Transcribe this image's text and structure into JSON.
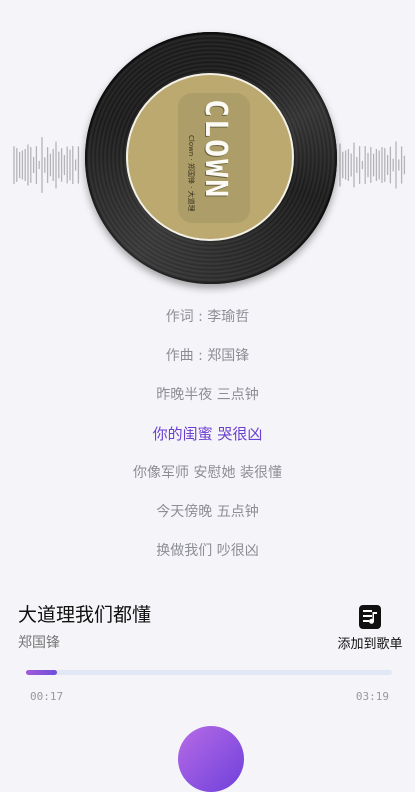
{
  "album": {
    "cover_title": "CLOWN",
    "cover_subtitle": "Clown · 郑国锋 · 大道理",
    "cover_color": "#bba970"
  },
  "lyrics": [
    {
      "text": "作词 : 李瑜哲",
      "active": false
    },
    {
      "text": "作曲 : 郑国锋",
      "active": false
    },
    {
      "text": "昨晚半夜 三点钟",
      "active": false
    },
    {
      "text": "你的闺蜜 哭很凶",
      "active": true
    },
    {
      "text": "你像军师 安慰她 装很懂",
      "active": false
    },
    {
      "text": "今天傍晚 五点钟",
      "active": false
    },
    {
      "text": "换做我们 吵很凶",
      "active": false
    }
  ],
  "song": {
    "title": "大道理我们都懂",
    "artist": "郑国锋"
  },
  "actions": {
    "add_to_playlist_label": "添加到歌单",
    "add_to_playlist_icon": "playlist-add-icon"
  },
  "playback": {
    "current_time": "00:17",
    "total_time": "03:19",
    "progress": 0.085,
    "accent": "#6b3fd0"
  }
}
